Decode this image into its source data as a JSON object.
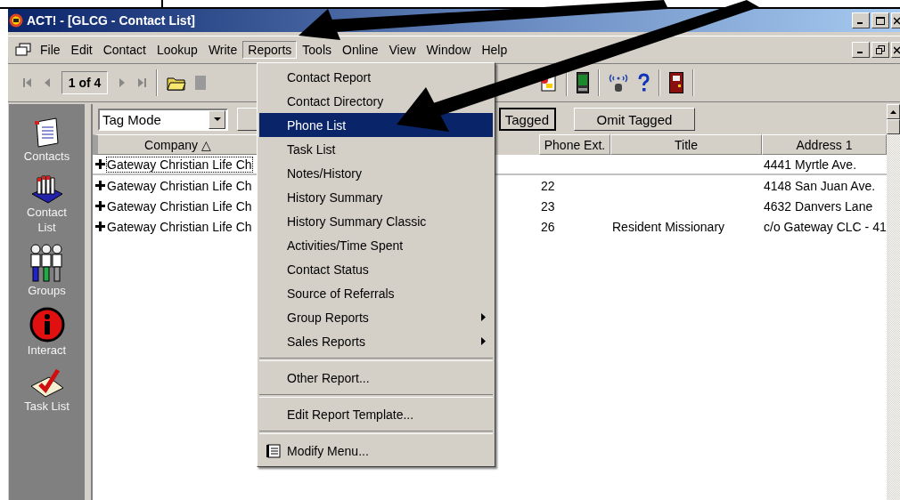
{
  "window": {
    "title": "ACT! - [GLCG - Contact List]"
  },
  "menu_bar": [
    {
      "label": "File",
      "selected": false
    },
    {
      "label": "Edit",
      "selected": false
    },
    {
      "label": "Contact",
      "selected": false
    },
    {
      "label": "Lookup",
      "selected": false
    },
    {
      "label": "Write",
      "selected": false
    },
    {
      "label": "Reports",
      "selected": true
    },
    {
      "label": "Tools",
      "selected": false
    },
    {
      "label": "Online",
      "selected": false
    },
    {
      "label": "View",
      "selected": false
    },
    {
      "label": "Window",
      "selected": false
    },
    {
      "label": "Help",
      "selected": false
    }
  ],
  "toolbar": {
    "record_counter": "1 of 4"
  },
  "sidebar": {
    "items": [
      {
        "label": "Contacts",
        "kind": "contacts"
      },
      {
        "label": "Contact List",
        "kind": "contact-list"
      },
      {
        "label": "Groups",
        "kind": "groups"
      },
      {
        "label": "Interact",
        "kind": "interact"
      },
      {
        "label": "Task List",
        "kind": "task-list"
      }
    ]
  },
  "tag_bar": {
    "mode_select": "Tag Mode",
    "buttons": [
      "Tagged",
      "Omit Tagged"
    ]
  },
  "table": {
    "columns": [
      {
        "label": "Company △",
        "kind": "company"
      },
      {
        "kind": "hidden"
      },
      {
        "label": "Phone Ext.",
        "kind": "text"
      },
      {
        "label": "Title",
        "kind": "text"
      },
      {
        "label": "Address 1",
        "kind": "text"
      }
    ],
    "rows": [
      {
        "cells": [
          "Gateway Christian Life Ch",
          "",
          "",
          "",
          "4441 Myrtle Ave."
        ],
        "selected": true
      },
      {
        "cells": [
          "Gateway Christian Life Ch",
          "",
          "22",
          "",
          "4148 San Juan Ave."
        ],
        "selected": false
      },
      {
        "cells": [
          "Gateway Christian Life Ch",
          "",
          "23",
          "",
          "4632 Danvers Lane"
        ],
        "selected": false
      },
      {
        "cells": [
          "Gateway Christian Life Ch",
          "",
          "26",
          "Resident Missionary",
          "c/o Gateway CLC - 41"
        ],
        "selected": false
      }
    ]
  },
  "reports_menu": {
    "items": [
      {
        "label": "Contact Report",
        "kind": "item",
        "selected": false
      },
      {
        "label": "Contact Directory",
        "kind": "item",
        "selected": false
      },
      {
        "label": "Phone List",
        "kind": "item",
        "selected": true
      },
      {
        "label": "Task List",
        "kind": "item",
        "selected": false
      },
      {
        "label": "Notes/History",
        "kind": "item",
        "selected": false
      },
      {
        "label": "History Summary",
        "kind": "item",
        "selected": false
      },
      {
        "label": "History Summary Classic",
        "kind": "item",
        "selected": false
      },
      {
        "label": "Activities/Time Spent",
        "kind": "item",
        "selected": false
      },
      {
        "label": "Contact Status",
        "kind": "item",
        "selected": false
      },
      {
        "label": "Source of Referrals",
        "kind": "item",
        "selected": false
      },
      {
        "label": "Group Reports",
        "kind": "submenu",
        "selected": false
      },
      {
        "label": "Sales Reports",
        "kind": "submenu",
        "selected": false
      },
      {
        "kind": "separator"
      },
      {
        "label": "Other Report...",
        "kind": "item",
        "selected": false
      },
      {
        "kind": "separator"
      },
      {
        "label": "Edit Report Template...",
        "kind": "item",
        "selected": false
      },
      {
        "kind": "separator"
      },
      {
        "label": "Modify Menu...",
        "kind": "tool-item",
        "selected": false
      }
    ]
  }
}
